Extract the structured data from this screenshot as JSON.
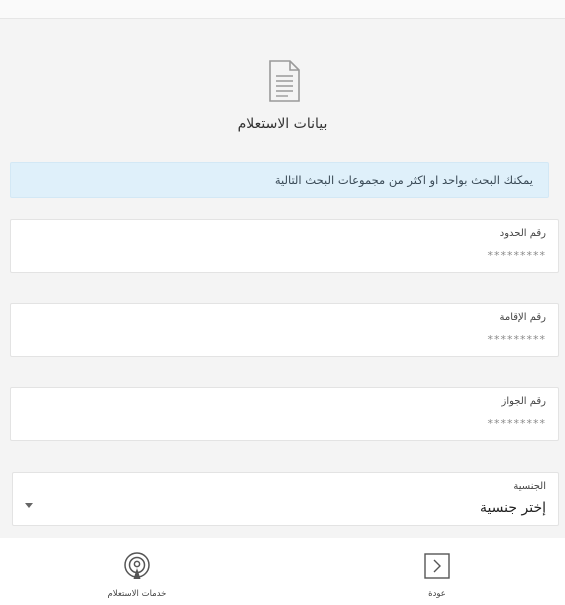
{
  "header": {
    "title": "بيانات الاستعلام",
    "icon": "document-icon"
  },
  "info": {
    "message": "يمكنك البحث بواحد او اكثر من مجموعات البحث التالية"
  },
  "fields": [
    {
      "label": "رقم الحدود",
      "placeholder": "*********"
    },
    {
      "label": "رقم الإقامة",
      "placeholder": "*********"
    },
    {
      "label": "رقم الجواز",
      "placeholder": "*********"
    }
  ],
  "nationality": {
    "label": "الجنسية",
    "value": "إختر جنسية"
  },
  "bottom_nav": {
    "back_label": "عودة",
    "back_icon": "chevron-right-icon",
    "services_label": "خدمات الاستعلام",
    "services_icon": "broadcast-icon"
  },
  "colors": {
    "background": "#f4f4f4",
    "info_background": "#dff0fa",
    "icon_gray": "#9a9a9a"
  }
}
